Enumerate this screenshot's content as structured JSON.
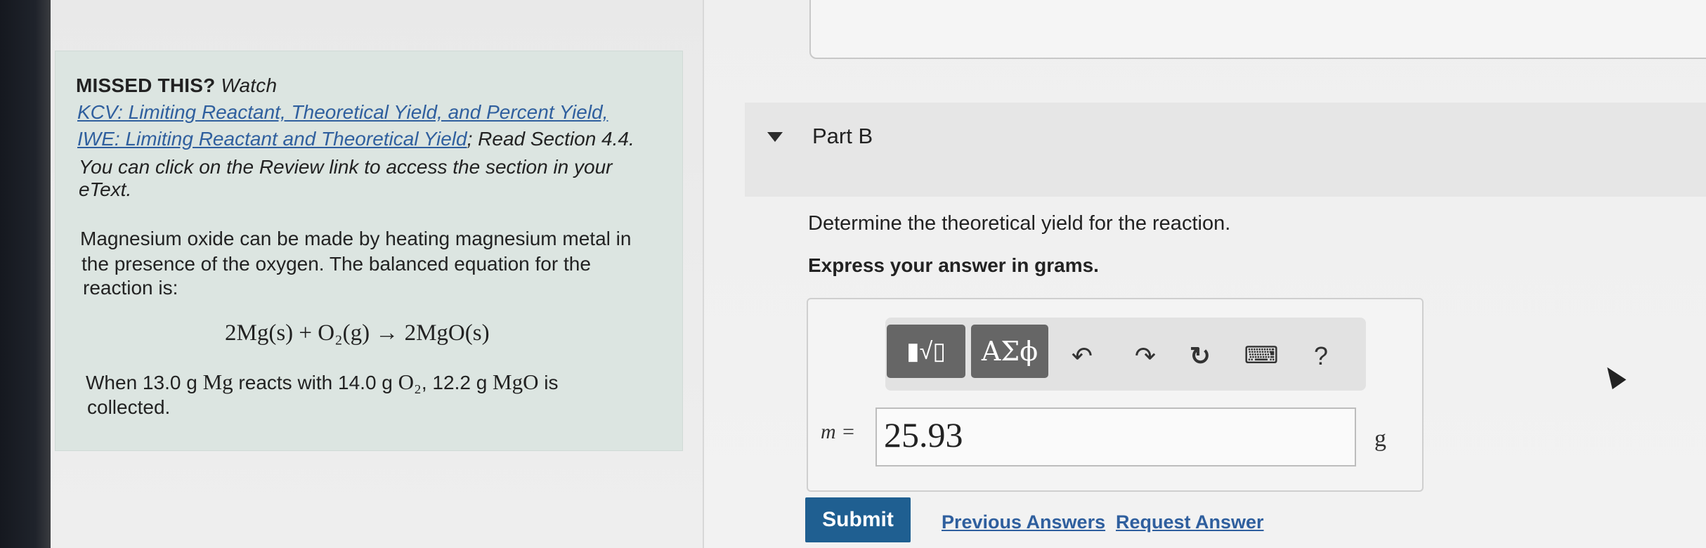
{
  "hint": {
    "title_bold": "MISSED THIS?",
    "title_italic": "Watch",
    "link1": "KCV: Limiting Reactant, Theoretical Yield, and Percent Yield,",
    "link2": "IWE: Limiting Reactant and Theoretical Yield",
    "after_link2": "; Read Section 4.4.",
    "line3": "You can click on the Review link to access the section in your",
    "line4": "eText."
  },
  "problem": {
    "line1": "Magnesium oxide can be made by heating magnesium metal in",
    "line2": "the presence of the oxygen. The balanced equation for the",
    "line3": "reaction is:",
    "equation": "2Mg(s) + O₂(g) → 2MgO(s)",
    "given_prefix": "When 13.0 g",
    "given_mg": "Mg",
    "given_mid1": "reacts with 14.0 g",
    "given_o2": "O₂",
    "given_mid2": ", 12.2 g",
    "given_mgo": "MgO",
    "given_suffix": "is",
    "given_line2": "collected."
  },
  "part_b": {
    "title": "Part B",
    "question": "Determine the theoretical yield for the reaction.",
    "instruction": "Express your answer in grams.",
    "variable": "m =",
    "answer_value": "25.93",
    "unit": "g"
  },
  "toolbar": {
    "template_label": "▮√▯",
    "symbols_label": "ΑΣϕ",
    "undo_icon": "↶",
    "redo_icon": "↷",
    "reset_icon": "↻",
    "keyboard_icon": "⌨",
    "help_label": "?"
  },
  "actions": {
    "submit": "Submit",
    "previous_answers": "Previous Answers",
    "request_answer": "Request Answer"
  }
}
